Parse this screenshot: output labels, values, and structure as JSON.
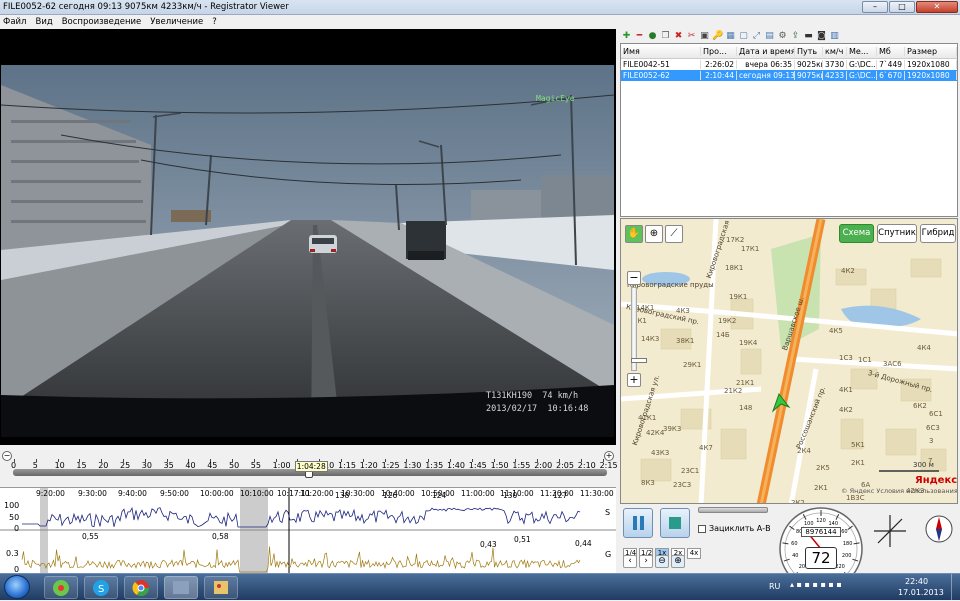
{
  "window": {
    "title": "FILE0052-62    сегодня 09:13    9075км    4233км/ч - Registrator Viewer",
    "btn_min": "–",
    "btn_max": "□",
    "btn_close": "✕"
  },
  "menu": [
    "Файл",
    "Вид",
    "Воспроизведение",
    "Увеличение",
    "?"
  ],
  "video": {
    "osd_id_speed": "T131KH190  74 km/h",
    "osd_datetime": "2013/02/17  10:16:48",
    "watermark": "MagicEye"
  },
  "timeline": {
    "ticks": [
      "0",
      "5",
      "10",
      "15",
      "20",
      "25",
      "30",
      "35",
      "40",
      "45",
      "50",
      "55",
      "1:00",
      "1:05",
      "1:10",
      "1:15",
      "1:20",
      "1:25",
      "1:30",
      "1:35",
      "1:40",
      "1:45",
      "1:50",
      "1:55",
      "2:00",
      "2:05",
      "2:10",
      "2:15"
    ],
    "current_time": "1:04:28",
    "slider_fraction": 0.498,
    "zoom_out_label": "−",
    "zoom_in_label": "+"
  },
  "graphs": {
    "clock_ticks": [
      "9:20:00",
      "9:30:00",
      "9:40:00",
      "9:50:00",
      "10:00:00",
      "10:10:00",
      "10:17:11",
      "10:20:00",
      "10:30:00",
      "10:40:00",
      "10:50:00",
      "11:00:00",
      "11:10:00",
      "11:20:00",
      "11:30:00"
    ],
    "speed_axis": [
      "100",
      "50",
      "0"
    ],
    "speed_label": "S",
    "speed_peaks": [
      "138",
      "126",
      "124",
      "130",
      "127"
    ],
    "g_axis": [
      "0.3",
      "0"
    ],
    "g_label": "G",
    "g_peaks": [
      "0,55",
      "0,58",
      "0,43",
      "0,51",
      "0,44"
    ]
  },
  "toolbar_icons": [
    "add-icon",
    "remove-icon",
    "globe-icon",
    "copy-icon",
    "delete-icon",
    "cut-icon",
    "save-icon",
    "key-icon",
    "screenshot-icon",
    "crop-icon",
    "fullscreen-icon",
    "stack-icon",
    "settings-icon",
    "export-icon",
    "film-icon",
    "camera-icon",
    "chart-icon"
  ],
  "filelist": {
    "columns": [
      "Имя",
      "Про...",
      "Дата и время",
      "Путь",
      "км/ч",
      "Ме...",
      "Мб",
      "Размер"
    ],
    "rows": [
      [
        "FILE0042-51",
        "2:26:02",
        "вчера 06:35",
        "9025км",
        "3730",
        "G:\\DC...",
        "7`449",
        "1920x1080"
      ],
      [
        "FILE0052-62",
        "2:10:44",
        "сегодня 09:13",
        "9075км",
        "4233",
        "G:\\DC...",
        "6`670",
        "1920x1080"
      ]
    ],
    "selected_index": 1
  },
  "map": {
    "types": [
      "Схема",
      "Спутник",
      "Гибрид"
    ],
    "active_type": "Схема",
    "streets": [
      "Кировоградская ул.",
      "Варшавское ш.",
      "Россошанский пр.",
      "3-й Дорожный пр.",
      "Кировоградские пруды",
      "Кировоградский пр.",
      "Кировоградская ул."
    ],
    "buildings": [
      "17К2",
      "17К1",
      "18К1",
      "19К1",
      "19К2",
      "14К1",
      "14К3",
      "3К1",
      "4К3",
      "38К1",
      "14Б",
      "19К4",
      "21К1",
      "21К2",
      "29К1",
      "148",
      "41К1",
      "39К3",
      "4К2",
      "4К5",
      "1С3",
      "1С1",
      "3АС6",
      "4К4",
      "4К1",
      "4К2",
      "5К1",
      "6А",
      "6К2",
      "6С1",
      "6С3",
      "3",
      "7",
      "42К3",
      "42К4",
      "43К3",
      "4К7",
      "8К3",
      "23С1",
      "23С3",
      "1В3С",
      "2К1",
      "2К4",
      "2К5",
      "2К1",
      "2К2"
    ],
    "scale": "300 м",
    "copyright": "© Яндекс  Условия использования",
    "logo": "Яндекс"
  },
  "playback": {
    "loop_label": "Зациклить А-В",
    "speed_buttons": [
      "1/4",
      "1/2",
      "1x",
      "2x",
      "4x"
    ],
    "active_speed": "1x"
  },
  "gauge": {
    "odometer": "8976144",
    "speed": "72",
    "dial_marks": [
      "20",
      "40",
      "60",
      "80",
      "100",
      "120",
      "140",
      "160",
      "180",
      "200",
      "220"
    ]
  },
  "taskbar": {
    "lang": "RU",
    "time": "22:40",
    "date": "17.01.2013"
  }
}
